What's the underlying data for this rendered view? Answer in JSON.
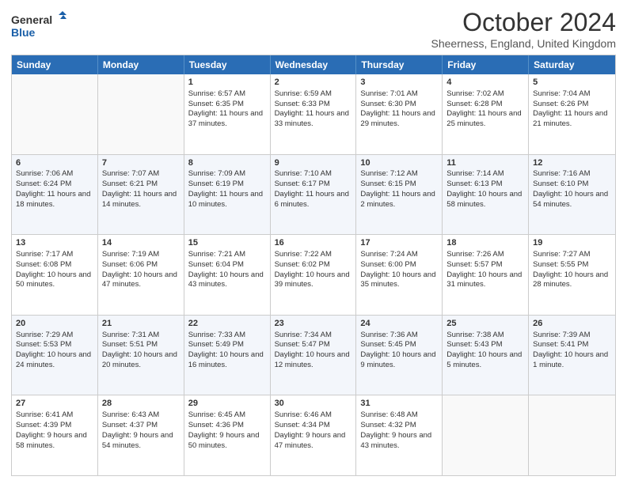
{
  "header": {
    "logo_line1": "General",
    "logo_line2": "Blue",
    "month_title": "October 2024",
    "location": "Sheerness, England, United Kingdom"
  },
  "calendar": {
    "days_of_week": [
      "Sunday",
      "Monday",
      "Tuesday",
      "Wednesday",
      "Thursday",
      "Friday",
      "Saturday"
    ],
    "rows": [
      [
        {
          "day": "",
          "empty": true
        },
        {
          "day": "",
          "empty": true
        },
        {
          "day": "1",
          "line1": "Sunrise: 6:57 AM",
          "line2": "Sunset: 6:35 PM",
          "line3": "Daylight: 11 hours and 37 minutes."
        },
        {
          "day": "2",
          "line1": "Sunrise: 6:59 AM",
          "line2": "Sunset: 6:33 PM",
          "line3": "Daylight: 11 hours and 33 minutes."
        },
        {
          "day": "3",
          "line1": "Sunrise: 7:01 AM",
          "line2": "Sunset: 6:30 PM",
          "line3": "Daylight: 11 hours and 29 minutes."
        },
        {
          "day": "4",
          "line1": "Sunrise: 7:02 AM",
          "line2": "Sunset: 6:28 PM",
          "line3": "Daylight: 11 hours and 25 minutes."
        },
        {
          "day": "5",
          "line1": "Sunrise: 7:04 AM",
          "line2": "Sunset: 6:26 PM",
          "line3": "Daylight: 11 hours and 21 minutes."
        }
      ],
      [
        {
          "day": "6",
          "line1": "Sunrise: 7:06 AM",
          "line2": "Sunset: 6:24 PM",
          "line3": "Daylight: 11 hours and 18 minutes."
        },
        {
          "day": "7",
          "line1": "Sunrise: 7:07 AM",
          "line2": "Sunset: 6:21 PM",
          "line3": "Daylight: 11 hours and 14 minutes."
        },
        {
          "day": "8",
          "line1": "Sunrise: 7:09 AM",
          "line2": "Sunset: 6:19 PM",
          "line3": "Daylight: 11 hours and 10 minutes."
        },
        {
          "day": "9",
          "line1": "Sunrise: 7:10 AM",
          "line2": "Sunset: 6:17 PM",
          "line3": "Daylight: 11 hours and 6 minutes."
        },
        {
          "day": "10",
          "line1": "Sunrise: 7:12 AM",
          "line2": "Sunset: 6:15 PM",
          "line3": "Daylight: 11 hours and 2 minutes."
        },
        {
          "day": "11",
          "line1": "Sunrise: 7:14 AM",
          "line2": "Sunset: 6:13 PM",
          "line3": "Daylight: 10 hours and 58 minutes."
        },
        {
          "day": "12",
          "line1": "Sunrise: 7:16 AM",
          "line2": "Sunset: 6:10 PM",
          "line3": "Daylight: 10 hours and 54 minutes."
        }
      ],
      [
        {
          "day": "13",
          "line1": "Sunrise: 7:17 AM",
          "line2": "Sunset: 6:08 PM",
          "line3": "Daylight: 10 hours and 50 minutes."
        },
        {
          "day": "14",
          "line1": "Sunrise: 7:19 AM",
          "line2": "Sunset: 6:06 PM",
          "line3": "Daylight: 10 hours and 47 minutes."
        },
        {
          "day": "15",
          "line1": "Sunrise: 7:21 AM",
          "line2": "Sunset: 6:04 PM",
          "line3": "Daylight: 10 hours and 43 minutes."
        },
        {
          "day": "16",
          "line1": "Sunrise: 7:22 AM",
          "line2": "Sunset: 6:02 PM",
          "line3": "Daylight: 10 hours and 39 minutes."
        },
        {
          "day": "17",
          "line1": "Sunrise: 7:24 AM",
          "line2": "Sunset: 6:00 PM",
          "line3": "Daylight: 10 hours and 35 minutes."
        },
        {
          "day": "18",
          "line1": "Sunrise: 7:26 AM",
          "line2": "Sunset: 5:57 PM",
          "line3": "Daylight: 10 hours and 31 minutes."
        },
        {
          "day": "19",
          "line1": "Sunrise: 7:27 AM",
          "line2": "Sunset: 5:55 PM",
          "line3": "Daylight: 10 hours and 28 minutes."
        }
      ],
      [
        {
          "day": "20",
          "line1": "Sunrise: 7:29 AM",
          "line2": "Sunset: 5:53 PM",
          "line3": "Daylight: 10 hours and 24 minutes."
        },
        {
          "day": "21",
          "line1": "Sunrise: 7:31 AM",
          "line2": "Sunset: 5:51 PM",
          "line3": "Daylight: 10 hours and 20 minutes."
        },
        {
          "day": "22",
          "line1": "Sunrise: 7:33 AM",
          "line2": "Sunset: 5:49 PM",
          "line3": "Daylight: 10 hours and 16 minutes."
        },
        {
          "day": "23",
          "line1": "Sunrise: 7:34 AM",
          "line2": "Sunset: 5:47 PM",
          "line3": "Daylight: 10 hours and 12 minutes."
        },
        {
          "day": "24",
          "line1": "Sunrise: 7:36 AM",
          "line2": "Sunset: 5:45 PM",
          "line3": "Daylight: 10 hours and 9 minutes."
        },
        {
          "day": "25",
          "line1": "Sunrise: 7:38 AM",
          "line2": "Sunset: 5:43 PM",
          "line3": "Daylight: 10 hours and 5 minutes."
        },
        {
          "day": "26",
          "line1": "Sunrise: 7:39 AM",
          "line2": "Sunset: 5:41 PM",
          "line3": "Daylight: 10 hours and 1 minute."
        }
      ],
      [
        {
          "day": "27",
          "line1": "Sunrise: 6:41 AM",
          "line2": "Sunset: 4:39 PM",
          "line3": "Daylight: 9 hours and 58 minutes."
        },
        {
          "day": "28",
          "line1": "Sunrise: 6:43 AM",
          "line2": "Sunset: 4:37 PM",
          "line3": "Daylight: 9 hours and 54 minutes."
        },
        {
          "day": "29",
          "line1": "Sunrise: 6:45 AM",
          "line2": "Sunset: 4:36 PM",
          "line3": "Daylight: 9 hours and 50 minutes."
        },
        {
          "day": "30",
          "line1": "Sunrise: 6:46 AM",
          "line2": "Sunset: 4:34 PM",
          "line3": "Daylight: 9 hours and 47 minutes."
        },
        {
          "day": "31",
          "line1": "Sunrise: 6:48 AM",
          "line2": "Sunset: 4:32 PM",
          "line3": "Daylight: 9 hours and 43 minutes."
        },
        {
          "day": "",
          "empty": true
        },
        {
          "day": "",
          "empty": true
        }
      ]
    ]
  }
}
